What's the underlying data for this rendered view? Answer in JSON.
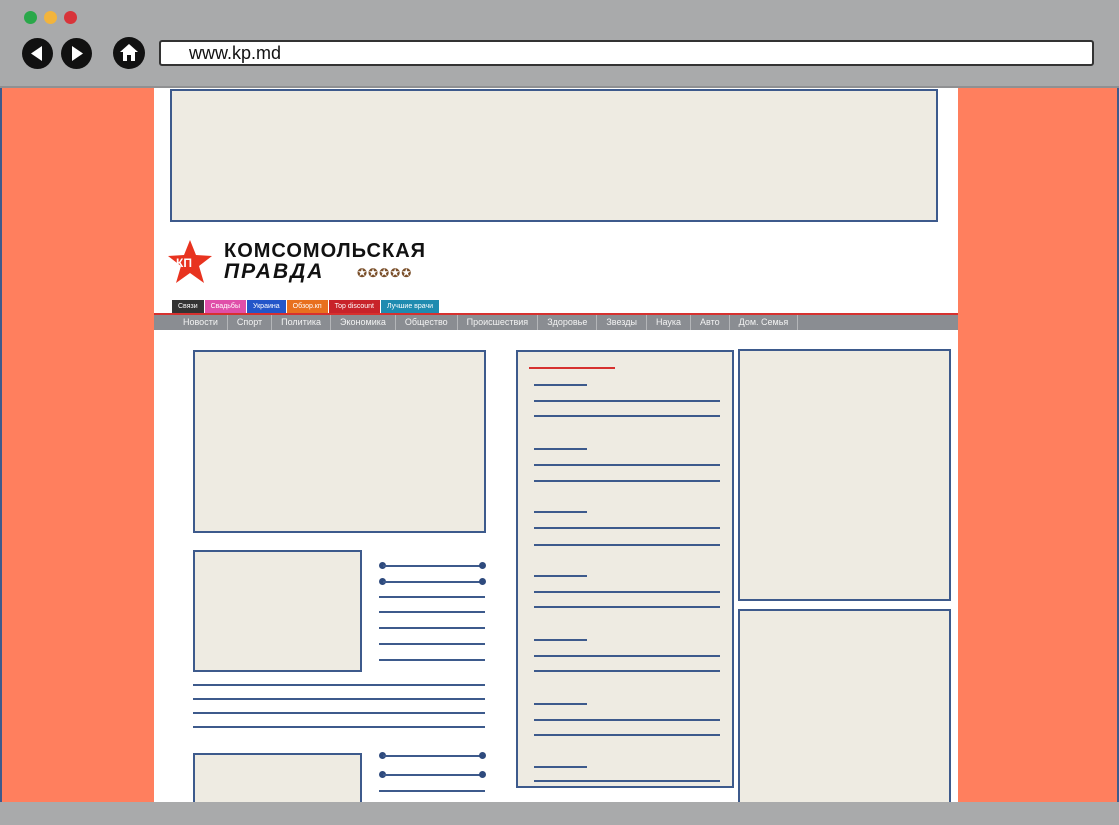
{
  "browser": {
    "url": "www.kp.md",
    "dot_colors": [
      "#2aa84a",
      "#f2b43c",
      "#d8343a"
    ]
  },
  "header": {
    "logo_badge": "КП",
    "logo_line1": "КОМСОМОЛЬСКАЯ",
    "logo_line2": "ПРАВДА",
    "orders_glyphs": "✪✪✪✪✪"
  },
  "tags": [
    {
      "label": "Связи",
      "color": "#333333"
    },
    {
      "label": "Свадьбы",
      "color": "#e04fa9"
    },
    {
      "label": "Украина",
      "color": "#2356c9"
    },
    {
      "label": "Обзор.кп",
      "color": "#e8701e"
    },
    {
      "label": "Top discount",
      "color": "#c8232a"
    },
    {
      "label": "Лучшие врачи",
      "color": "#1e8bb0"
    }
  ],
  "nav": [
    "Новости",
    "Спорт",
    "Политика",
    "Экономика",
    "Общество",
    "Происшествия",
    "Здоровье",
    "Звезды",
    "Наука",
    "Авто",
    "Дом. Семья"
  ],
  "colors": {
    "gutter": "#ff7f5e",
    "placeholder": "#eeebe2",
    "outline": "#3d5a8c",
    "accent_red": "#d6312f"
  }
}
